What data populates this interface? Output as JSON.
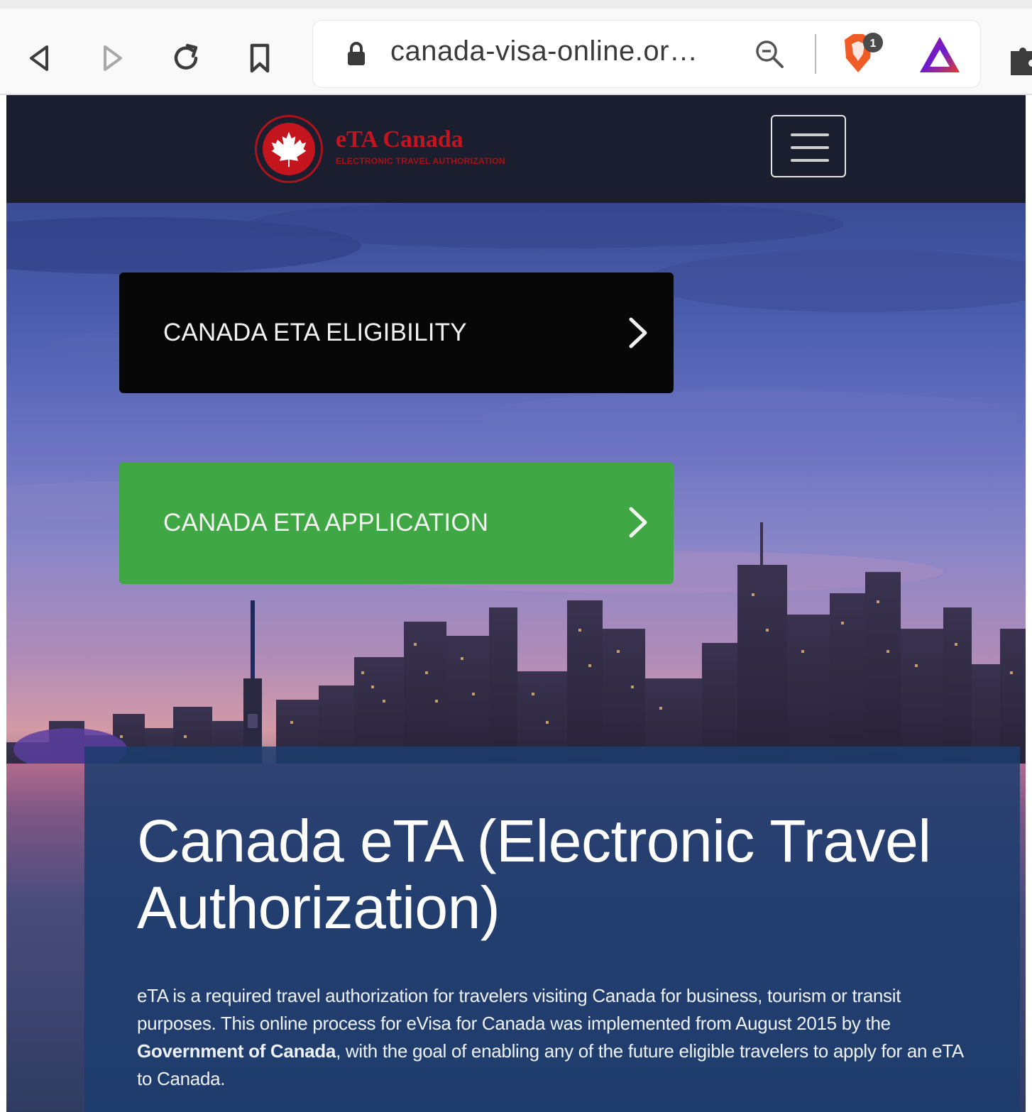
{
  "browser": {
    "url_display": "canada-visa-online.or…",
    "icons": [
      "back-icon",
      "forward-icon",
      "reload-icon",
      "bookmark-icon",
      "lock-icon",
      "zoom-icon",
      "brave-shield-icon",
      "brave-rewards-icon",
      "extensions-icon"
    ],
    "shield_badge": "1"
  },
  "header": {
    "logo_title": "eTA Canada",
    "logo_subtitle": "ELECTRONIC TRAVEL AUTHORIZATION",
    "menu_icon": "hamburger-menu-icon"
  },
  "hero": {
    "eligibility_label": "CANADA ETA ELIGIBILITY",
    "application_label": "CANADA ETA APPLICATION",
    "title": "Canada eTA (Electronic Travel Authorization)",
    "text_part1": "eTA is a required travel authorization for travelers visiting Canada for business, tourism or transit purposes. This online process for eVisa for Canada was implemented from August 2015 by the ",
    "text_bold": "Government of Canada",
    "text_part2": ", with the goal of enabling any of the future eligible travelers to apply for an eTA to Canada."
  },
  "colors": {
    "header_bg": "#1b1e2e",
    "brand_red": "#c4151f",
    "eligibility_bg": "#070707",
    "application_bg": "#3fa844",
    "panel_bg": "#1c3c6e"
  }
}
